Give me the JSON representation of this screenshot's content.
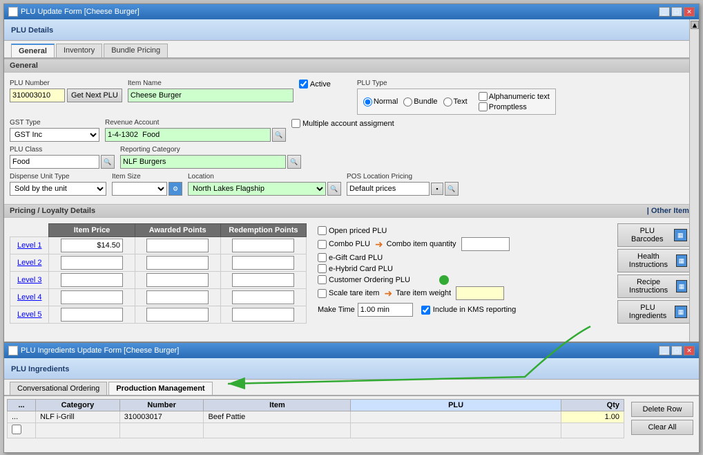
{
  "mainWindow": {
    "title": "PLU Update Form [Cheese Burger]",
    "header": "PLU Details"
  },
  "tabs": {
    "general": "General",
    "inventory": "Inventory",
    "bundlePricing": "Bundle Pricing"
  },
  "general": {
    "sectionLabel": "General",
    "pluNumber": {
      "label": "PLU Number",
      "value": "310003010"
    },
    "getNextPlu": "Get Next PLU",
    "itemName": {
      "label": "Item Name",
      "value": "Cheese Burger"
    },
    "active": {
      "label": "Active",
      "checked": true
    },
    "pluType": {
      "label": "PLU Type",
      "normal": "Normal",
      "bundle": "Bundle",
      "text": "Text",
      "alphanumeric": "Alphanumeric text",
      "promptless": "Promptless",
      "selected": "Normal"
    },
    "gstType": {
      "label": "GST Type",
      "value": "GST Inc"
    },
    "revenueAccount": {
      "label": "Revenue Account",
      "value": "1-4-1302  Food"
    },
    "multipleAccount": "Multiple account assigment",
    "pluClass": {
      "label": "PLU Class",
      "value": "Food"
    },
    "reportingCategory": {
      "label": "Reporting Category",
      "value": "NLF Burgers"
    },
    "dispenseUnitType": {
      "label": "Dispense Unit Type",
      "value": "Sold by the unit"
    },
    "itemSize": {
      "label": "Item Size",
      "value": ""
    },
    "location": {
      "label": "Location",
      "value": "North Lakes Flagship"
    },
    "posLocationPricing": {
      "label": "POS Location Pricing",
      "value": "Default prices"
    }
  },
  "pricing": {
    "sectionLabel": "Pricing / Loyalty Details",
    "otherItems": "| Other Items",
    "headers": {
      "itemPrice": "Item Price",
      "awardedPoints": "Awarded Points",
      "redemptionPoints": "Redemption Points"
    },
    "levels": [
      {
        "label": "Level 1",
        "itemPrice": "$14.50",
        "awardedPoints": "",
        "redemptionPoints": ""
      },
      {
        "label": "Level 2",
        "itemPrice": "",
        "awardedPoints": "",
        "redemptionPoints": ""
      },
      {
        "label": "Level 3",
        "itemPrice": "",
        "awardedPoints": "",
        "redemptionPoints": ""
      },
      {
        "label": "Level 4",
        "itemPrice": "",
        "awardedPoints": "",
        "redemptionPoints": ""
      },
      {
        "label": "Level 5",
        "itemPrice": "",
        "awardedPoints": "",
        "redemptionPoints": ""
      }
    ],
    "checkboxes": {
      "openPriced": "Open priced PLU",
      "comboPlu": "Combo PLU",
      "eGiftPlu": "e-Gift Card PLU",
      "eHybridPlu": "e-Hybrid Card PLU",
      "customerOrdering": "Customer Ordering PLU",
      "scaleTare": "Scale tare item"
    },
    "comboItemQty": "Combo item quantity",
    "tareItemWeight": "Tare item weight",
    "makeTime": {
      "label": "Make Time",
      "value": "1.00 min"
    },
    "includeKMS": "Include in KMS reporting",
    "buttons": {
      "pluBarcodes": "PLU Barcodes",
      "healthInstructions": "Health Instructions",
      "recipeInstructions": "Recipe Instructions",
      "pluIngredients": "PLU Ingredients"
    }
  },
  "ingredientWindow": {
    "title": "PLU Ingredients Update Form [Cheese Burger]",
    "header": "PLU Ingredients",
    "tabs": {
      "conversational": "Conversational Ordering",
      "production": "Production Management"
    },
    "tableHeaders": {
      "dots": "...",
      "category": "Category",
      "number": "Number",
      "item": "Item",
      "plu": "PLU",
      "qty": "Qty"
    },
    "rows": [
      {
        "dots": "...",
        "category": "NLF i-Grill",
        "number": "310003017",
        "item": "Beef Pattie",
        "qty": "1.00"
      }
    ],
    "buttons": {
      "deleteRow": "Delete Row",
      "clearAll": "Clear All"
    }
  }
}
